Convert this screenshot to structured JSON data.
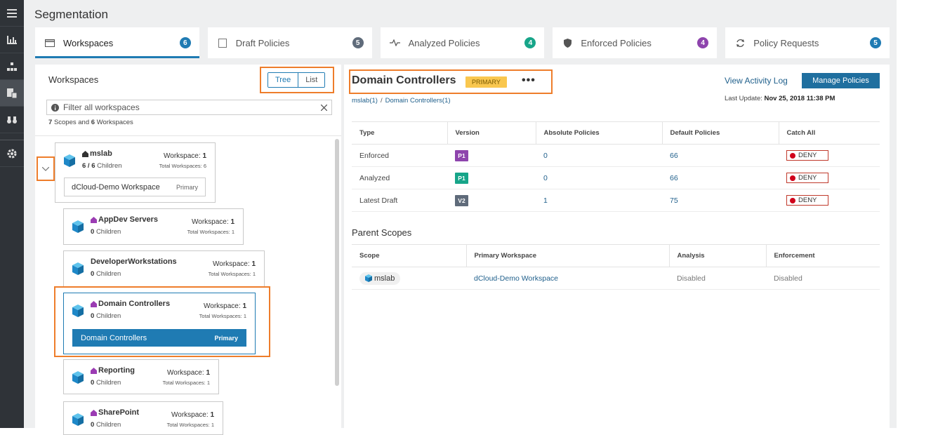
{
  "page": {
    "title": "Segmentation"
  },
  "nav": {
    "icons": [
      "menu-icon",
      "bar-chart-icon",
      "topology-icon",
      "policy-icon",
      "binoculars-icon",
      "gear-icon"
    ]
  },
  "tabs": [
    {
      "label": "Workspaces",
      "count": "6",
      "color": "#1f7bb3",
      "icon": "workspace-icon"
    },
    {
      "label": "Draft Policies",
      "count": "5",
      "color": "#5f6b7a",
      "icon": "draft-icon"
    },
    {
      "label": "Analyzed Policies",
      "count": "4",
      "color": "#17a589",
      "icon": "pulse-icon"
    },
    {
      "label": "Enforced Policies",
      "count": "4",
      "color": "#8e44ad",
      "icon": "shield-icon"
    },
    {
      "label": "Policy Requests",
      "count": "5",
      "color": "#1f7bb3",
      "icon": "refresh-icon"
    }
  ],
  "left": {
    "heading": "Workspaces",
    "toggle": {
      "tree": "Tree",
      "list": "List"
    },
    "filter": {
      "placeholder": "Filter all workspaces"
    },
    "counts": {
      "scopes": "7",
      "scopes_label": "Scopes and",
      "workspaces": "6",
      "workspaces_label": "Workspaces"
    },
    "root": {
      "name": "mslab",
      "children": "6 / 6",
      "children_label": "Children",
      "ws_label": "Workspace:",
      "ws": "1",
      "total": "Total Workspaces: 6",
      "workspace": "dCloud-Demo Workspace",
      "primary": "Primary"
    },
    "scopes": [
      {
        "name": "AppDev Servers",
        "children": "0",
        "children_label": "Children",
        "ws_label": "Workspace:",
        "ws": "1",
        "total": "Total Workspaces: 1"
      },
      {
        "name": "DeveloperWorkstations",
        "children": "0",
        "children_label": "Children",
        "ws_label": "Workspace:",
        "ws": "1",
        "total": "Total Workspaces: 1"
      },
      {
        "name": "Domain Controllers",
        "children": "0",
        "children_label": "Children",
        "ws_label": "Workspace:",
        "ws": "1",
        "total": "Total Workspaces: 1",
        "workspace": "Domain Controllers",
        "primary": "Primary"
      },
      {
        "name": "Reporting",
        "children": "0",
        "children_label": "Children",
        "ws_label": "Workspace:",
        "ws": "1",
        "total": "Total Workspaces: 1"
      },
      {
        "name": "SharePoint",
        "children": "0",
        "children_label": "Children",
        "ws_label": "Workspace:",
        "ws": "1",
        "total": "Total Workspaces: 1"
      }
    ]
  },
  "detail": {
    "title": "Domain Controllers",
    "badge": "PRIMARY",
    "more": "•••",
    "crumb": {
      "a": "mslab(1)",
      "b": "Domain Controllers(1)"
    },
    "activity": "View Activity Log",
    "manage": "Manage Policies",
    "last_update_label": "Last Update:",
    "last_update": "Nov 25, 2018 11:38 PM",
    "table": {
      "headers": [
        "Type",
        "Version",
        "Absolute Policies",
        "Default Policies",
        "Catch All"
      ],
      "rows": [
        {
          "type": "Enforced",
          "version": "P1",
          "vcolor": "#8e44ad",
          "abs": "0",
          "def": "66",
          "catch": "DENY"
        },
        {
          "type": "Analyzed",
          "version": "P1",
          "vcolor": "#17a589",
          "abs": "0",
          "def": "66",
          "catch": "DENY"
        },
        {
          "type": "Latest Draft",
          "version": "V2",
          "vcolor": "#5f6b7a",
          "abs": "1",
          "def": "75",
          "catch": "DENY"
        }
      ]
    },
    "parent_title": "Parent Scopes",
    "parent": {
      "headers": [
        "Scope",
        "Primary Workspace",
        "Analysis",
        "Enforcement"
      ],
      "rows": [
        {
          "scope": "mslab",
          "workspace": "dCloud-Demo Workspace",
          "analysis": "Disabled",
          "enforcement": "Disabled"
        }
      ]
    }
  }
}
